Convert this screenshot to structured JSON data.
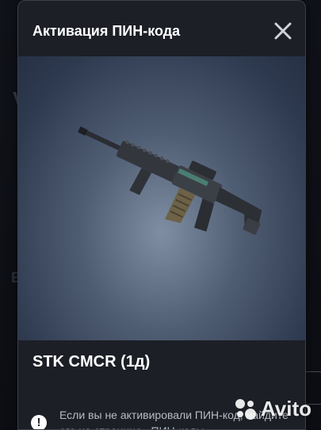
{
  "modal": {
    "title": "Активация ПИН-кода",
    "item_name": "STK CMCR (1д)",
    "notice_text": "Если вы не активировали ПИН-код, найдите его на странице «ПИН-коды»"
  },
  "watermark": {
    "text": "Avito"
  },
  "icons": {
    "close": "close-icon",
    "alert": "alert-icon",
    "weapon": "rifle-image"
  },
  "colors": {
    "modal_bg": "#1c1f26",
    "item_bg": "#4f5d73",
    "text": "#ffffff",
    "muted": "#b8bcc6"
  }
}
